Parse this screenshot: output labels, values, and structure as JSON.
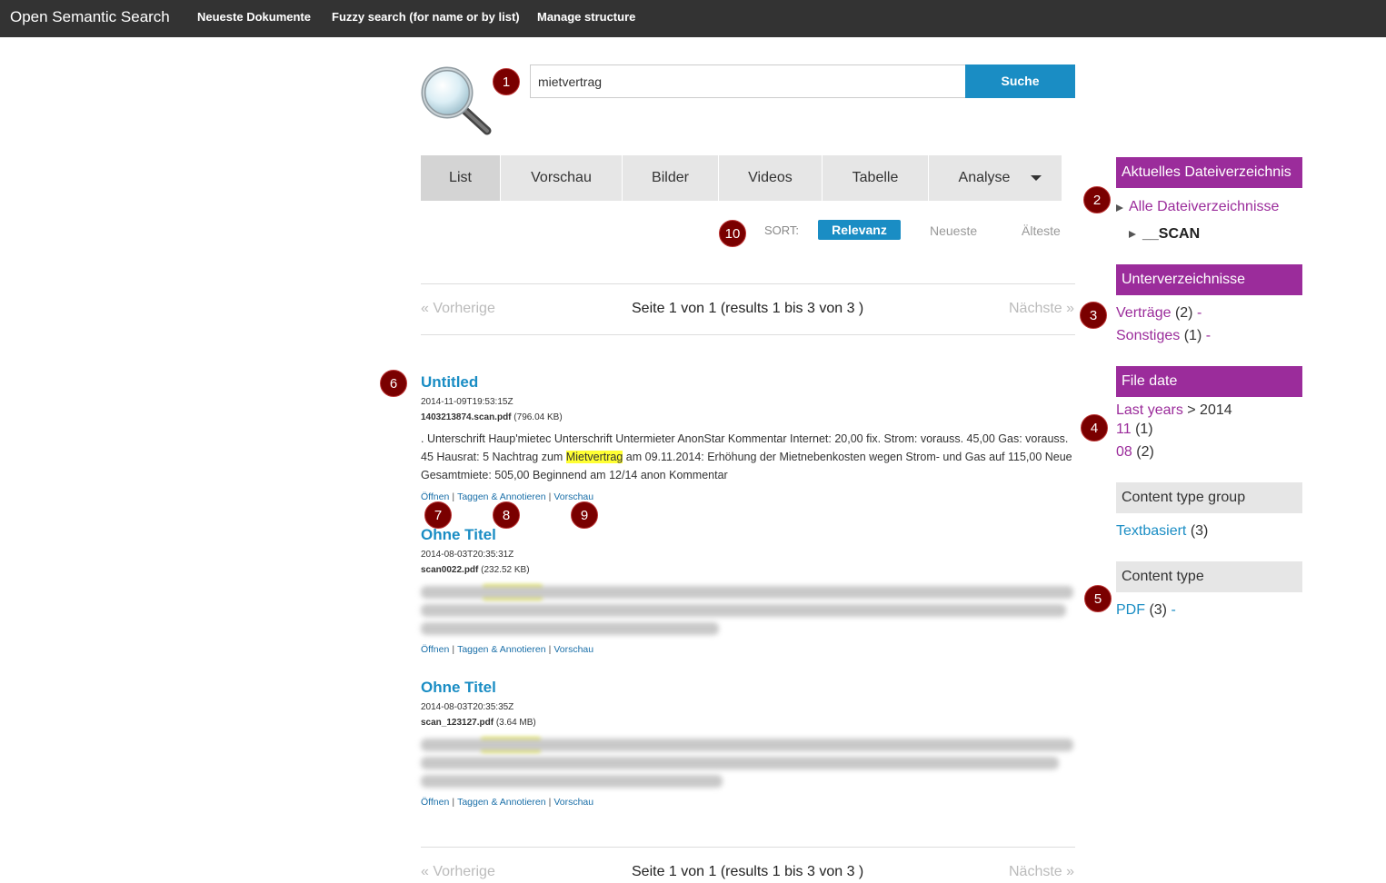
{
  "navbar": {
    "brand": "Open Semantic Search",
    "items": [
      "Neueste Dokumente",
      "Fuzzy search (for name or by list)",
      "Manage structure"
    ]
  },
  "search": {
    "query": "mietvertrag",
    "button_label": "Suche"
  },
  "badges": [
    "1",
    "2",
    "3",
    "4",
    "5",
    "6",
    "7",
    "8",
    "9",
    "10"
  ],
  "tabs": [
    {
      "label": "List",
      "active": true
    },
    {
      "label": "Vorschau"
    },
    {
      "label": "Bilder"
    },
    {
      "label": "Videos"
    },
    {
      "label": "Tabelle"
    },
    {
      "label": "Analyse"
    }
  ],
  "sort": {
    "label": "SORT:",
    "options": [
      "Relevanz",
      "Neueste",
      "Älteste"
    ],
    "active": "Relevanz"
  },
  "pager": {
    "prev": "« Vorherige",
    "info": "Seite 1 von 1 (results 1 bis 3 von 3 )",
    "next": "Nächste »"
  },
  "results": [
    {
      "title": "Untitled",
      "date": "2014-11-09T19:53:15Z",
      "filename": "1403213874.scan.pdf",
      "size": "(796.04 KB)",
      "snippet_before": ". Unterschrift Haup'mietec Unterschrift Untermieter AnonStar Kommentar Internet: 20,00 fix. Strom: vorauss. 45,00 Gas: vorauss. 45 Hausrat: 5 Nachtrag zum ",
      "snippet_highlight": "Mietvertrag",
      "snippet_after": " am 09.11.2014: Erhöhung der Mietnebenkosten wegen Strom- und Gas auf 115,00 Neue Gesamtmiete: 505,00 Beginnend am 12/14 anon Kommentar",
      "actions": [
        "Öffnen",
        "Taggen & Annotieren",
        "Vorschau"
      ]
    },
    {
      "title": "Ohne Titel",
      "date": "2014-08-03T20:35:31Z",
      "filename": "scan0022.pdf",
      "size": "(232.52 KB)",
      "actions": [
        "Öffnen",
        "Taggen & Annotieren",
        "Vorschau"
      ]
    },
    {
      "title": "Ohne Titel",
      "date": "2014-08-03T20:35:35Z",
      "filename": "scan_123127.pdf",
      "size": "(3.64 MB)",
      "actions": [
        "Öffnen",
        "Taggen & Annotieren",
        "Vorschau"
      ]
    }
  ],
  "sidebar": {
    "current_dir": {
      "title": "Aktuelles Dateiverzeichnis",
      "all_link": "Alle Dateiverzeichnisse",
      "current": "__SCAN"
    },
    "subdirs": {
      "title": "Unterverzeichnisse",
      "items": [
        {
          "label": "Verträge",
          "count": "(2)",
          "dash": "-"
        },
        {
          "label": "Sonstiges",
          "count": "(1)",
          "dash": "-"
        }
      ]
    },
    "file_date": {
      "title": "File date",
      "breadcrumb_link": "Last years",
      "breadcrumb_rest": "> 2014",
      "items": [
        {
          "label": "11",
          "count": "(1)"
        },
        {
          "label": "08",
          "count": "(2)"
        }
      ]
    },
    "content_type_group": {
      "title": "Content type group",
      "items": [
        {
          "label": "Textbasiert",
          "count": "(3)"
        }
      ]
    },
    "content_type": {
      "title": "Content type",
      "items": [
        {
          "label": "PDF",
          "count": "(3)",
          "dash": "-"
        }
      ]
    }
  },
  "colors": {
    "topbar": "#333333",
    "accent_blue": "#1a8dc4",
    "facet_purple": "#9b2c9b",
    "badge_red": "#7a0000",
    "highlight": "#ffff33"
  }
}
